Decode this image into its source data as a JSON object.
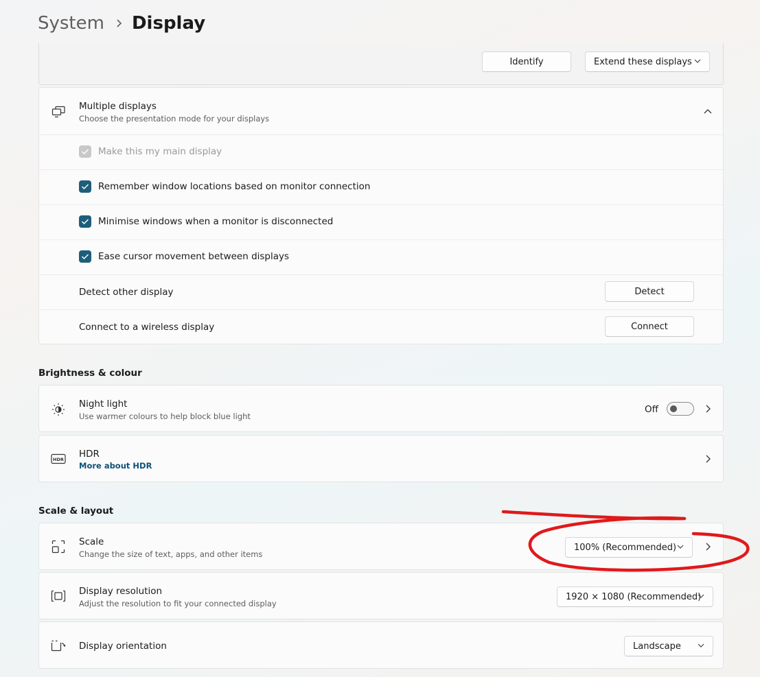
{
  "breadcrumb": {
    "parent": "System",
    "current": "Display"
  },
  "top_actions": {
    "identify": "Identify",
    "arrangement_mode": "Extend these displays"
  },
  "multiple_displays": {
    "title": "Multiple displays",
    "subtitle": "Choose the presentation mode for your displays",
    "expanded": true,
    "options": [
      {
        "label": "Make this my main display",
        "checked": true,
        "disabled": true
      },
      {
        "label": "Remember window locations based on monitor connection",
        "checked": true,
        "disabled": false
      },
      {
        "label": "Minimise windows when a monitor is disconnected",
        "checked": true,
        "disabled": false
      },
      {
        "label": "Ease cursor movement between displays",
        "checked": true,
        "disabled": false
      }
    ],
    "detect": {
      "label": "Detect other display",
      "button": "Detect"
    },
    "connect": {
      "label": "Connect to a wireless display",
      "button": "Connect"
    }
  },
  "brightness": {
    "heading": "Brightness & colour",
    "night_light": {
      "title": "Night light",
      "subtitle": "Use warmer colours to help block blue light",
      "state": "Off"
    },
    "hdr": {
      "title": "HDR",
      "link": "More about HDR"
    }
  },
  "scale_layout": {
    "heading": "Scale & layout",
    "scale": {
      "title": "Scale",
      "subtitle": "Change the size of text, apps, and other items",
      "value": "100% (Recommended)"
    },
    "resolution": {
      "title": "Display resolution",
      "subtitle": "Adjust the resolution to fit your connected display",
      "value": "1920 × 1080 (Recommended)"
    },
    "orientation": {
      "title": "Display orientation",
      "value": "Landscape"
    }
  },
  "colors": {
    "accent": "#1d5f7a",
    "annotation": "#e0191c"
  },
  "icons": [
    "chevron-right-icon",
    "multiple-displays-icon",
    "chevron-up-icon",
    "check-icon",
    "night-light-icon",
    "hdr-icon",
    "scale-icon",
    "resolution-icon",
    "orientation-icon",
    "chevron-down-icon"
  ]
}
